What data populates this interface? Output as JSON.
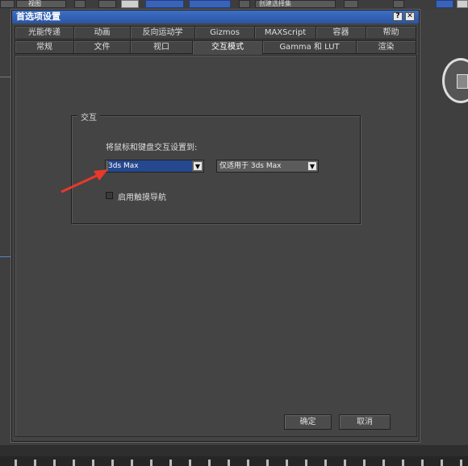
{
  "app": {
    "viewport_label": "视图",
    "selection_set_label": "创建选择集"
  },
  "dialog": {
    "title": "首选项设置",
    "help_btn": "?",
    "close_btn": "✕",
    "tabs_row1": [
      "光能传递",
      "动画",
      "反向运动学",
      "Gizmos",
      "MAXScript",
      "容器",
      "帮助"
    ],
    "tabs_row2": [
      "常规",
      "文件",
      "视口",
      "交互模式",
      "Gamma 和 LUT",
      "渲染"
    ],
    "active_tab": "交互模式",
    "group_title": "交互",
    "mouse_keyboard_label": "将鼠标和键盘交互设置到:",
    "mode_dropdown_value": "3ds Max",
    "scope_dropdown_value": "仅适用于 3ds Max",
    "touch_nav_label": "启用触摸导航",
    "touch_nav_checked": false,
    "ok_label": "确定",
    "cancel_label": "取消"
  },
  "colors": {
    "title_bar": "#2a55a5",
    "selection_highlight": "#26488f",
    "annotation_arrow": "#e8392b"
  },
  "icons": {
    "dropdown_arrow": "triangle-down",
    "annotation": "red-arrow"
  }
}
